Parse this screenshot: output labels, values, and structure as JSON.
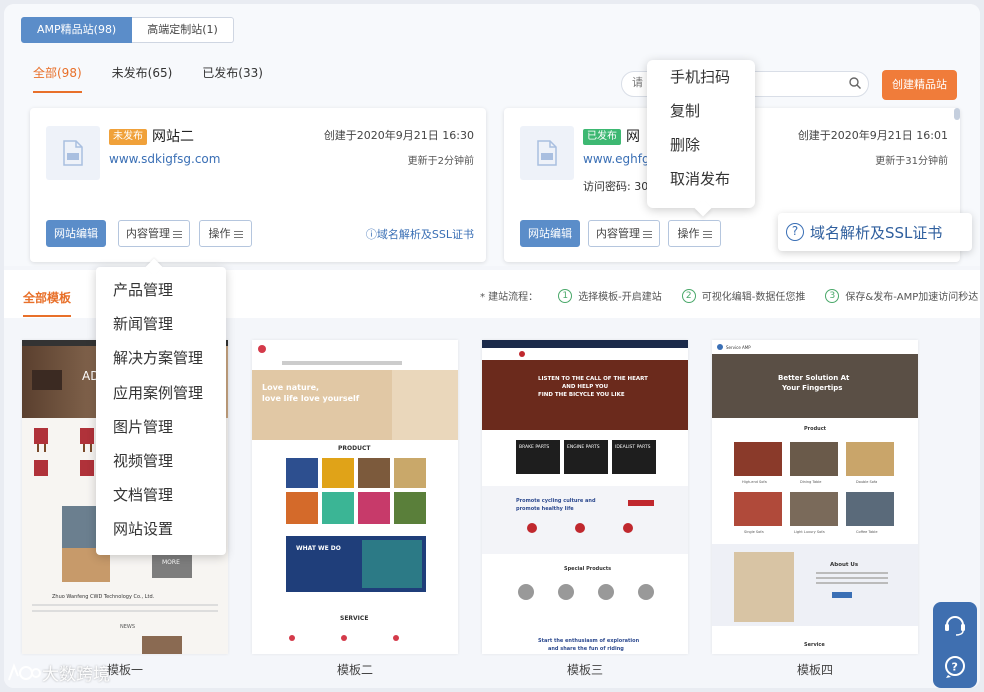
{
  "site_type_tabs": [
    {
      "label": "AMP精品站(98)",
      "active": true
    },
    {
      "label": "高端定制站(1)",
      "active": false
    }
  ],
  "status_tabs": [
    {
      "label": "全部(98)",
      "active": true
    },
    {
      "label": "未发布(65)",
      "active": false
    },
    {
      "label": "已发布(33)",
      "active": false
    }
  ],
  "search": {
    "placeholder": "请"
  },
  "create_button": "创建精品站",
  "cards": [
    {
      "badge": "未发布",
      "badge_color": "#f0a13a",
      "name": "网站二",
      "domain": "www.sdkigfsg.com",
      "password": "",
      "created": "创建于2020年9月21日 16:30",
      "updated": "更新于2分钟前",
      "edit_button": "网站编辑",
      "content_button": "内容管理",
      "ops_button": "操作",
      "dns_link": "域名解析及SSL证书"
    },
    {
      "badge": "已发布",
      "badge_color": "#3db872",
      "name": "网",
      "domain": "www.eghfg",
      "password": "访问密码: 301",
      "created": "创建于2020年9月21日 16:01",
      "updated": "更新于31分钟前",
      "edit_button": "网站编辑",
      "content_button": "内容管理",
      "ops_button": "操作",
      "dns_link": ""
    }
  ],
  "ops_menu": [
    "手机扫码",
    "复制",
    "删除",
    "取消发布"
  ],
  "dns_callout": "域名解析及SSL证书",
  "template_section": {
    "tab": "全部模板",
    "flow_label": "* 建站流程：",
    "steps": [
      {
        "num": "1",
        "text": "选择模板-开启建站"
      },
      {
        "num": "2",
        "text": "可视化编辑-数据任您推"
      },
      {
        "num": "3",
        "text": "保存&发布-AMP加速访问秒达"
      }
    ]
  },
  "content_menu": [
    "产品管理",
    "新闻管理",
    "解决方案管理",
    "应用案例管理",
    "图片管理",
    "视频管理",
    "文档管理",
    "网站设置"
  ],
  "templates": [
    {
      "name": "模板一",
      "hero_text": "AD",
      "footer_title": "Zhuo Wanfeng CWD Technology Co., Ltd.",
      "news_label": "NEWS",
      "tile_label": "MORE"
    },
    {
      "name": "模板二",
      "hero_text_1": "Love nature,",
      "hero_text_2": "love life love yourself",
      "section_1": "PRODUCT",
      "section_2": "WHAT WE DO",
      "section_3": "SERVICE"
    },
    {
      "name": "模板三",
      "hero_text_1": "LISTEN TO THE CALL OF THE HEART",
      "hero_text_2": "AND HELP YOU",
      "hero_text_3": "FIND THE BICYCLE YOU LIKE",
      "cats": [
        "BRAKE PARTS",
        "ENGINE PARTS",
        "IDEALIST PARTS"
      ],
      "promo_1": "Promote cycling culture and",
      "promo_2": "promote healthy life",
      "special": "Special Products",
      "bottom_1": "Start the enthusiasm of exploration",
      "bottom_2": "and share the fun of riding"
    },
    {
      "name": "模板四",
      "brand": "Service AMP",
      "hero_1": "Better Solution At",
      "hero_2": "Your Fingertips",
      "section_1": "Product",
      "products": [
        "High-end Sofa",
        "Dining Table",
        "Double Sofa",
        "Single Sofa",
        "Light Luxury Sofa",
        "Coffee Table"
      ],
      "about": "About Us",
      "service": "Service"
    }
  ],
  "watermark": "大数跨境"
}
